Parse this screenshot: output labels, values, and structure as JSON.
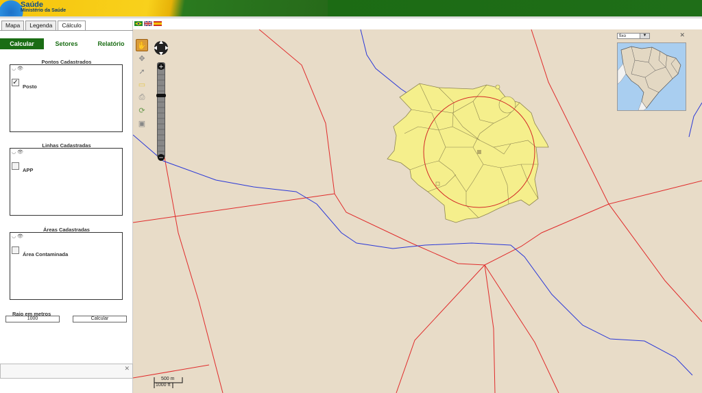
{
  "header": {
    "title": "Saúde",
    "subtitle": "Ministério da Saúde"
  },
  "tabs": [
    {
      "label": "Mapa",
      "active": false
    },
    {
      "label": "Legenda",
      "active": false
    },
    {
      "label": "Cálculo",
      "active": true
    }
  ],
  "subtabs": [
    {
      "label": "Calcular",
      "active": true
    },
    {
      "label": "Setores",
      "active": false
    },
    {
      "label": "Relatório",
      "active": false
    }
  ],
  "groups": {
    "pontos": {
      "title": "Pontos Cadastrados",
      "item": "Posto",
      "checked": true
    },
    "linhas": {
      "title": "Linhas Cadastradas",
      "item": "APP",
      "checked": false
    },
    "areas": {
      "title": "Áreas Cadastradas",
      "item": "Área Contaminada",
      "checked": false
    }
  },
  "raio": {
    "label": "Raio em metros",
    "value": "1000",
    "button": "Calcular"
  },
  "bottom_panel": {
    "close": "✕"
  },
  "minimap": {
    "select_value": "fixo",
    "close": "✕"
  },
  "scale": {
    "metric": "500 m",
    "imperial": "1000 ft"
  },
  "colors": {
    "brand_green": "#1a6d14",
    "map_bg": "#e8dcc8",
    "road_red": "#e02a2a",
    "river_blue": "#2a38d8",
    "sector_fill": "#f5ef8c"
  },
  "icons": [
    "pan-icon",
    "zoom-box-icon",
    "info-icon",
    "comment-icon",
    "print-icon",
    "refresh-icon",
    "export-icon"
  ]
}
